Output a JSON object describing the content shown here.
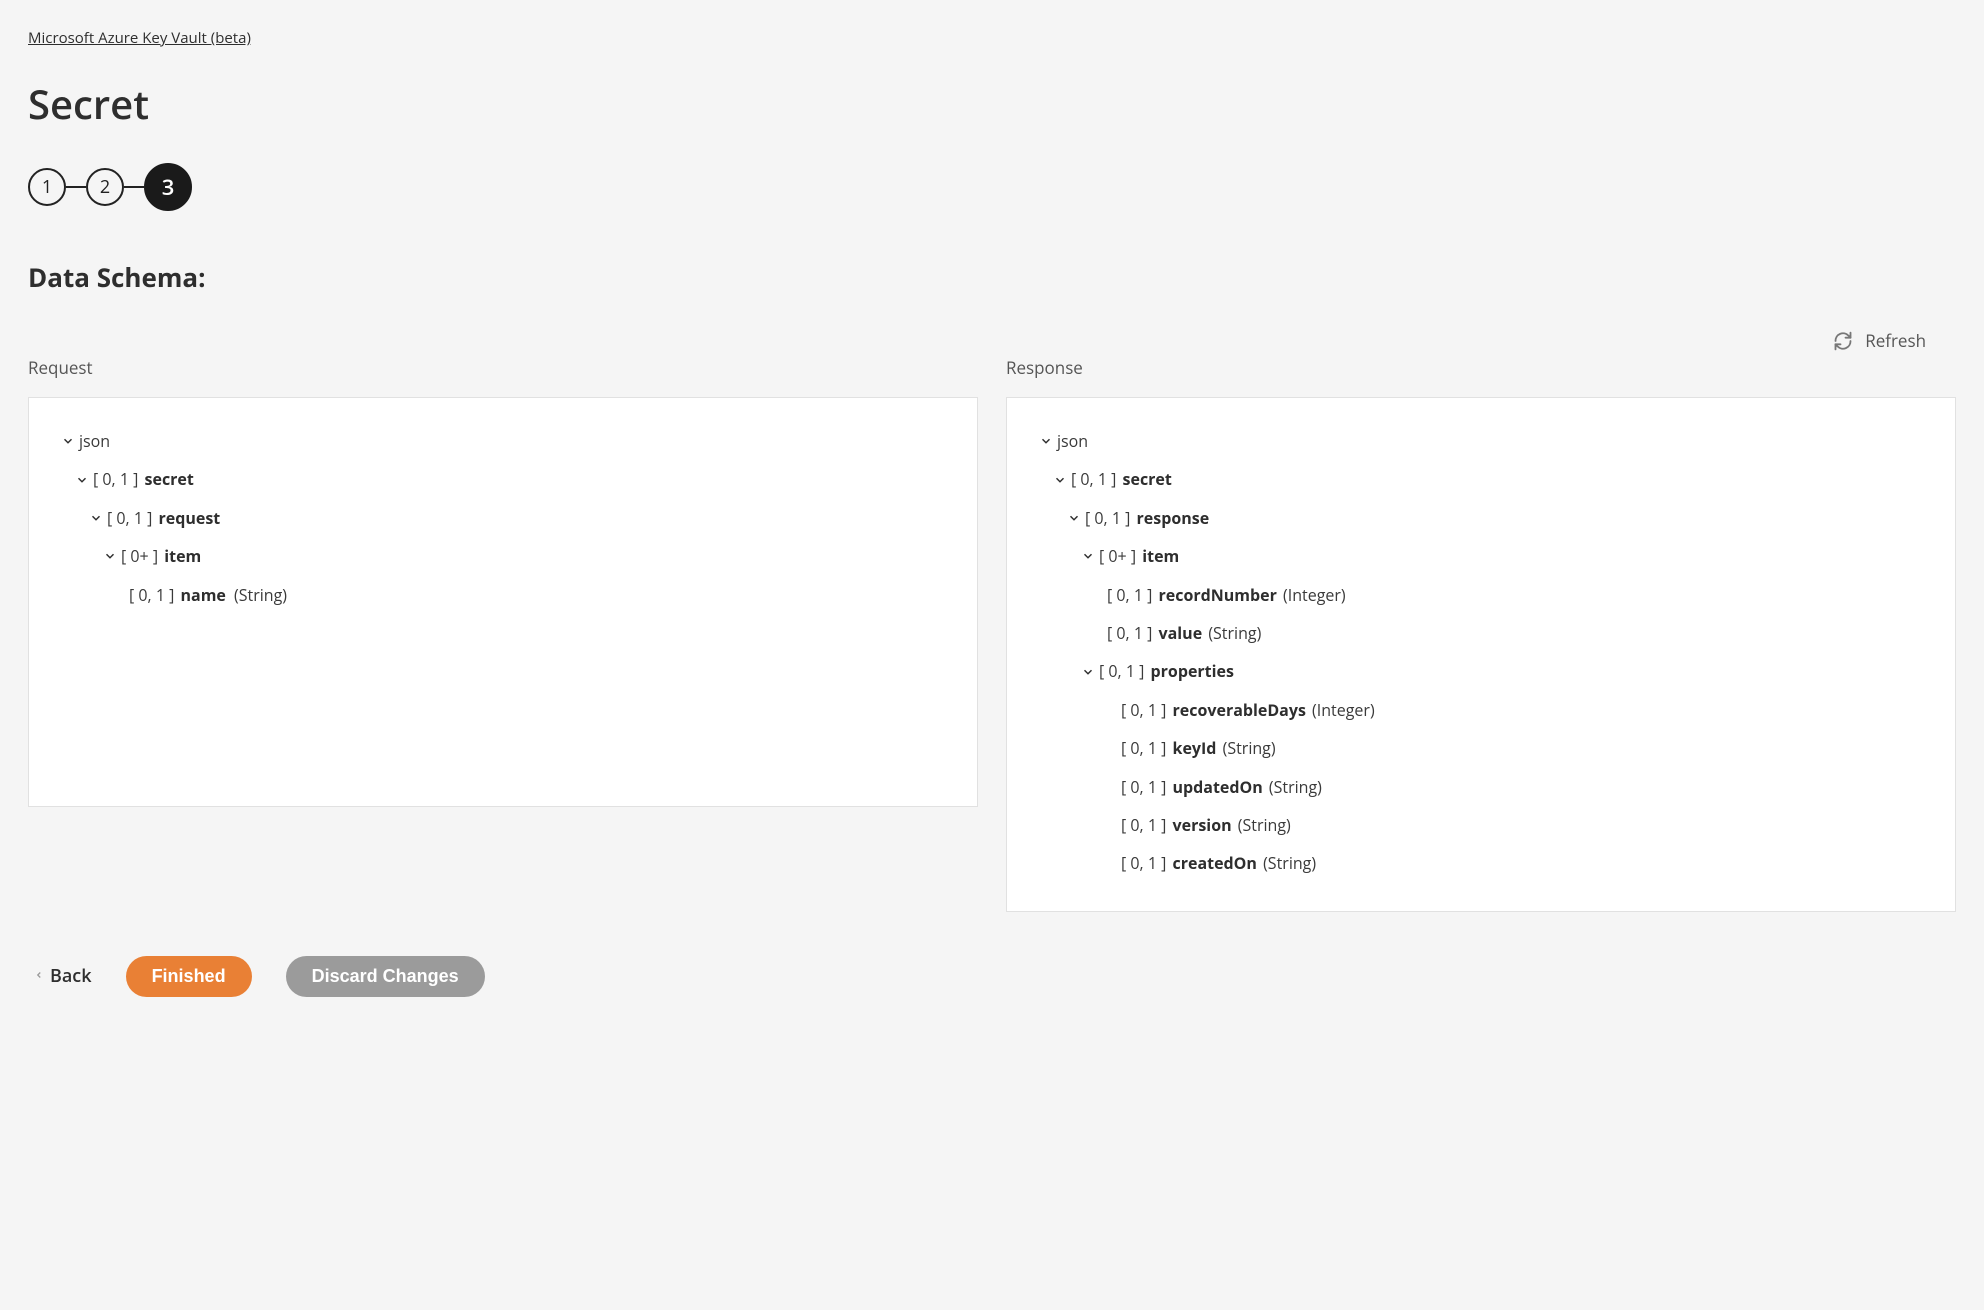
{
  "breadcrumb": "Microsoft Azure Key Vault (beta)",
  "title": "Secret",
  "stepper": {
    "s1": "1",
    "s2": "2",
    "s3": "3"
  },
  "sectionHeading": "Data Schema:",
  "refreshLabel": "Refresh",
  "columns": {
    "request": "Request",
    "response": "Response"
  },
  "requestTree": {
    "root": "json",
    "secret": {
      "card": "[ 0, 1 ]",
      "name": "secret"
    },
    "request": {
      "card": "[ 0, 1 ]",
      "name": "request"
    },
    "item": {
      "card": "[ 0+ ]",
      "name": "item"
    },
    "nameField": {
      "card": "[ 0, 1 ]",
      "name": "name",
      "type": "(String)"
    }
  },
  "responseTree": {
    "root": "json",
    "secret": {
      "card": "[ 0, 1 ]",
      "name": "secret"
    },
    "response": {
      "card": "[ 0, 1 ]",
      "name": "response"
    },
    "item": {
      "card": "[ 0+ ]",
      "name": "item"
    },
    "recordNumber": {
      "card": "[ 0, 1 ]",
      "name": "recordNumber",
      "type": "(Integer)"
    },
    "value": {
      "card": "[ 0, 1 ]",
      "name": "value",
      "type": "(String)"
    },
    "properties": {
      "card": "[ 0, 1 ]",
      "name": "properties"
    },
    "recoverableDays": {
      "card": "[ 0, 1 ]",
      "name": "recoverableDays",
      "type": "(Integer)"
    },
    "keyId": {
      "card": "[ 0, 1 ]",
      "name": "keyId",
      "type": "(String)"
    },
    "updatedOn": {
      "card": "[ 0, 1 ]",
      "name": "updatedOn",
      "type": "(String)"
    },
    "version": {
      "card": "[ 0, 1 ]",
      "name": "version",
      "type": "(String)"
    },
    "createdOn": {
      "card": "[ 0, 1 ]",
      "name": "createdOn",
      "type": "(String)"
    }
  },
  "footer": {
    "back": "Back",
    "finished": "Finished",
    "discard": "Discard Changes"
  }
}
